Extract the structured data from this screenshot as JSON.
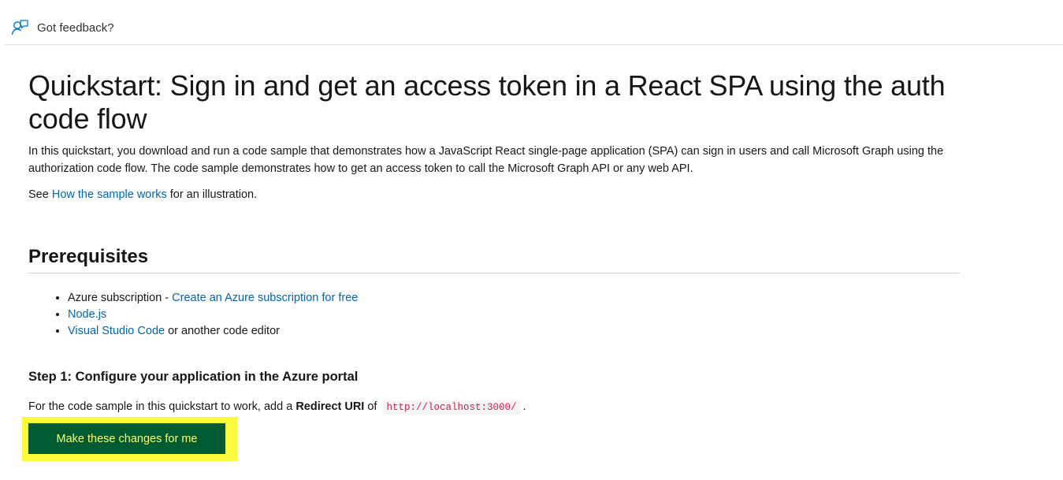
{
  "feedback": {
    "label": "Got feedback?",
    "icon": "person-feedback-icon"
  },
  "page": {
    "title": "Quickstart: Sign in and get an access token in a React SPA using the auth code flow",
    "intro": "In this quickstart, you download and run a code sample that demonstrates how a JavaScript React single-page application (SPA) can sign in users and call Microsoft Graph using the authorization code flow. The code sample demonstrates how to get an access token to call the Microsoft Graph API or any web API.",
    "see_prefix": "See ",
    "see_link": "How the sample works",
    "see_suffix": " for an illustration."
  },
  "prerequisites": {
    "heading": "Prerequisites",
    "items": [
      {
        "prefix": "Azure subscription - ",
        "link": "Create an Azure subscription for free",
        "suffix": ""
      },
      {
        "prefix": "",
        "link": "Node.js",
        "suffix": ""
      },
      {
        "prefix": "",
        "link": "Visual Studio Code",
        "suffix": " or another code editor"
      }
    ]
  },
  "step1": {
    "heading": "Step 1: Configure your application in the Azure portal",
    "text_prefix": "For the code sample in this quickstart to work, add a ",
    "text_bold": "Redirect URI",
    "text_middle": " of ",
    "redirect_uri": "http://localhost:3000/",
    "text_suffix": ".",
    "button_label": "Make these changes for me"
  },
  "colors": {
    "link": "#0065b3",
    "button_bg": "#005a32",
    "button_text": "#ffff66",
    "highlight": "#fbfb3c",
    "code_text": "#c7254e"
  }
}
